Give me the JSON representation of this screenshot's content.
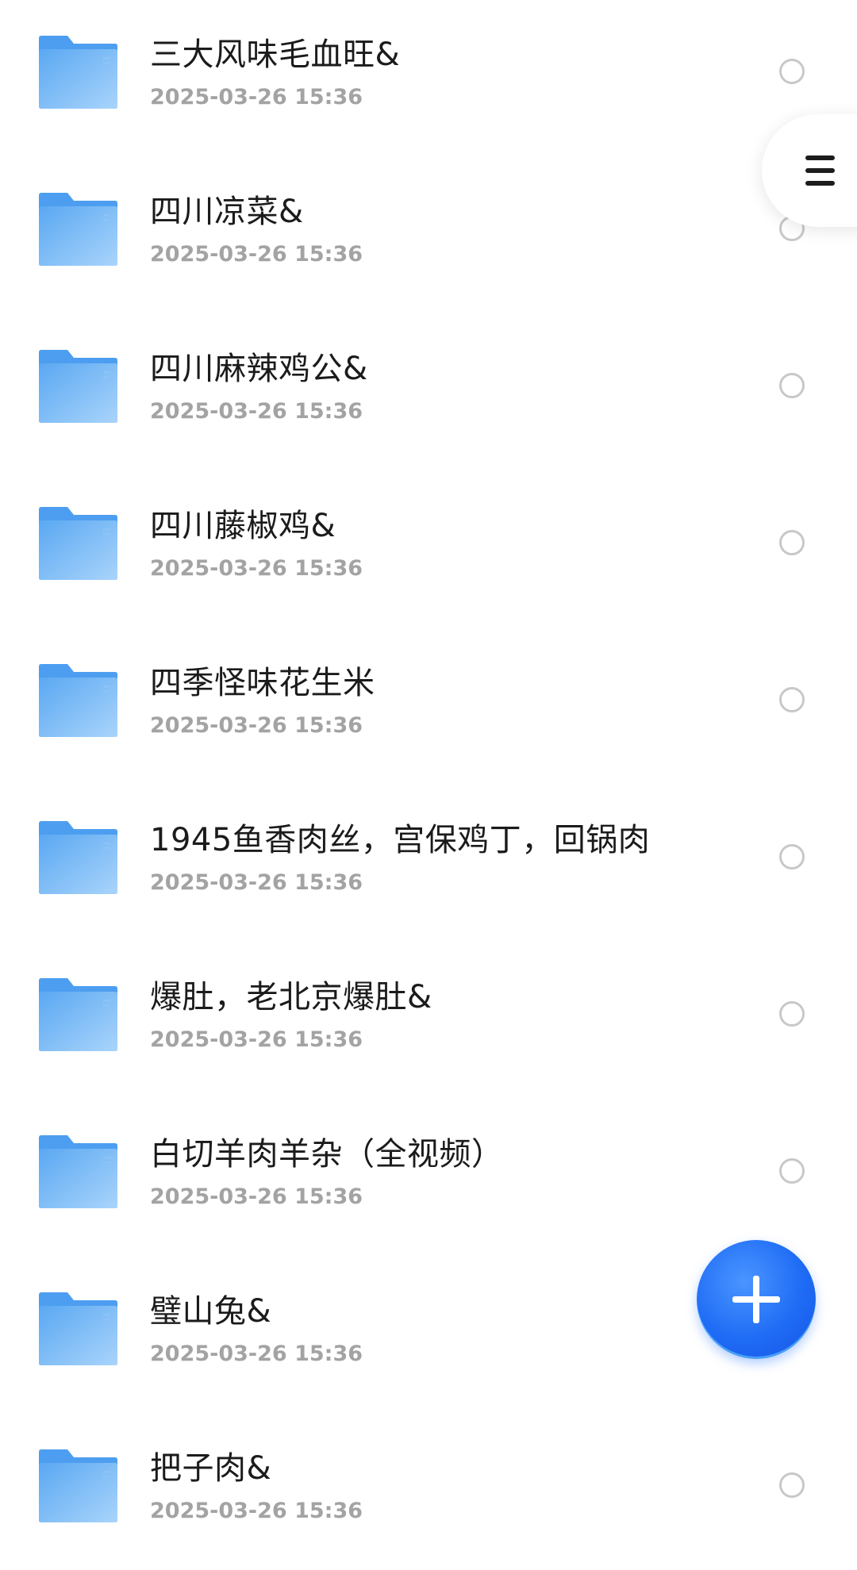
{
  "files": [
    {
      "name": "三大风味毛血旺&",
      "date": "2025-03-26 15:36"
    },
    {
      "name": "四川凉菜&",
      "date": "2025-03-26 15:36"
    },
    {
      "name": "四川麻辣鸡公&",
      "date": "2025-03-26 15:36"
    },
    {
      "name": "四川藤椒鸡&",
      "date": "2025-03-26 15:36"
    },
    {
      "name": "四季怪味花生米",
      "date": "2025-03-26 15:36"
    },
    {
      "name": "1945鱼香肉丝，宫保鸡丁，回锅肉",
      "date": "2025-03-26 15:36"
    },
    {
      "name": "爆肚，老北京爆肚&",
      "date": "2025-03-26 15:36"
    },
    {
      "name": "白切羊肉羊杂（全视频）",
      "date": "2025-03-26 15:36"
    },
    {
      "name": "璧山兔&",
      "date": "2025-03-26 15:36"
    },
    {
      "name": "把子肉&",
      "date": "2025-03-26 15:36"
    }
  ],
  "icons": {
    "folder": "folder-icon",
    "menu": "hamburger-menu-icon",
    "add": "plus-icon"
  },
  "colors": {
    "folder_blue": "#5aa8f2",
    "fab_blue": "#1f6cf5",
    "title_text": "#1b1b1b",
    "date_text": "#a3a3a3"
  }
}
